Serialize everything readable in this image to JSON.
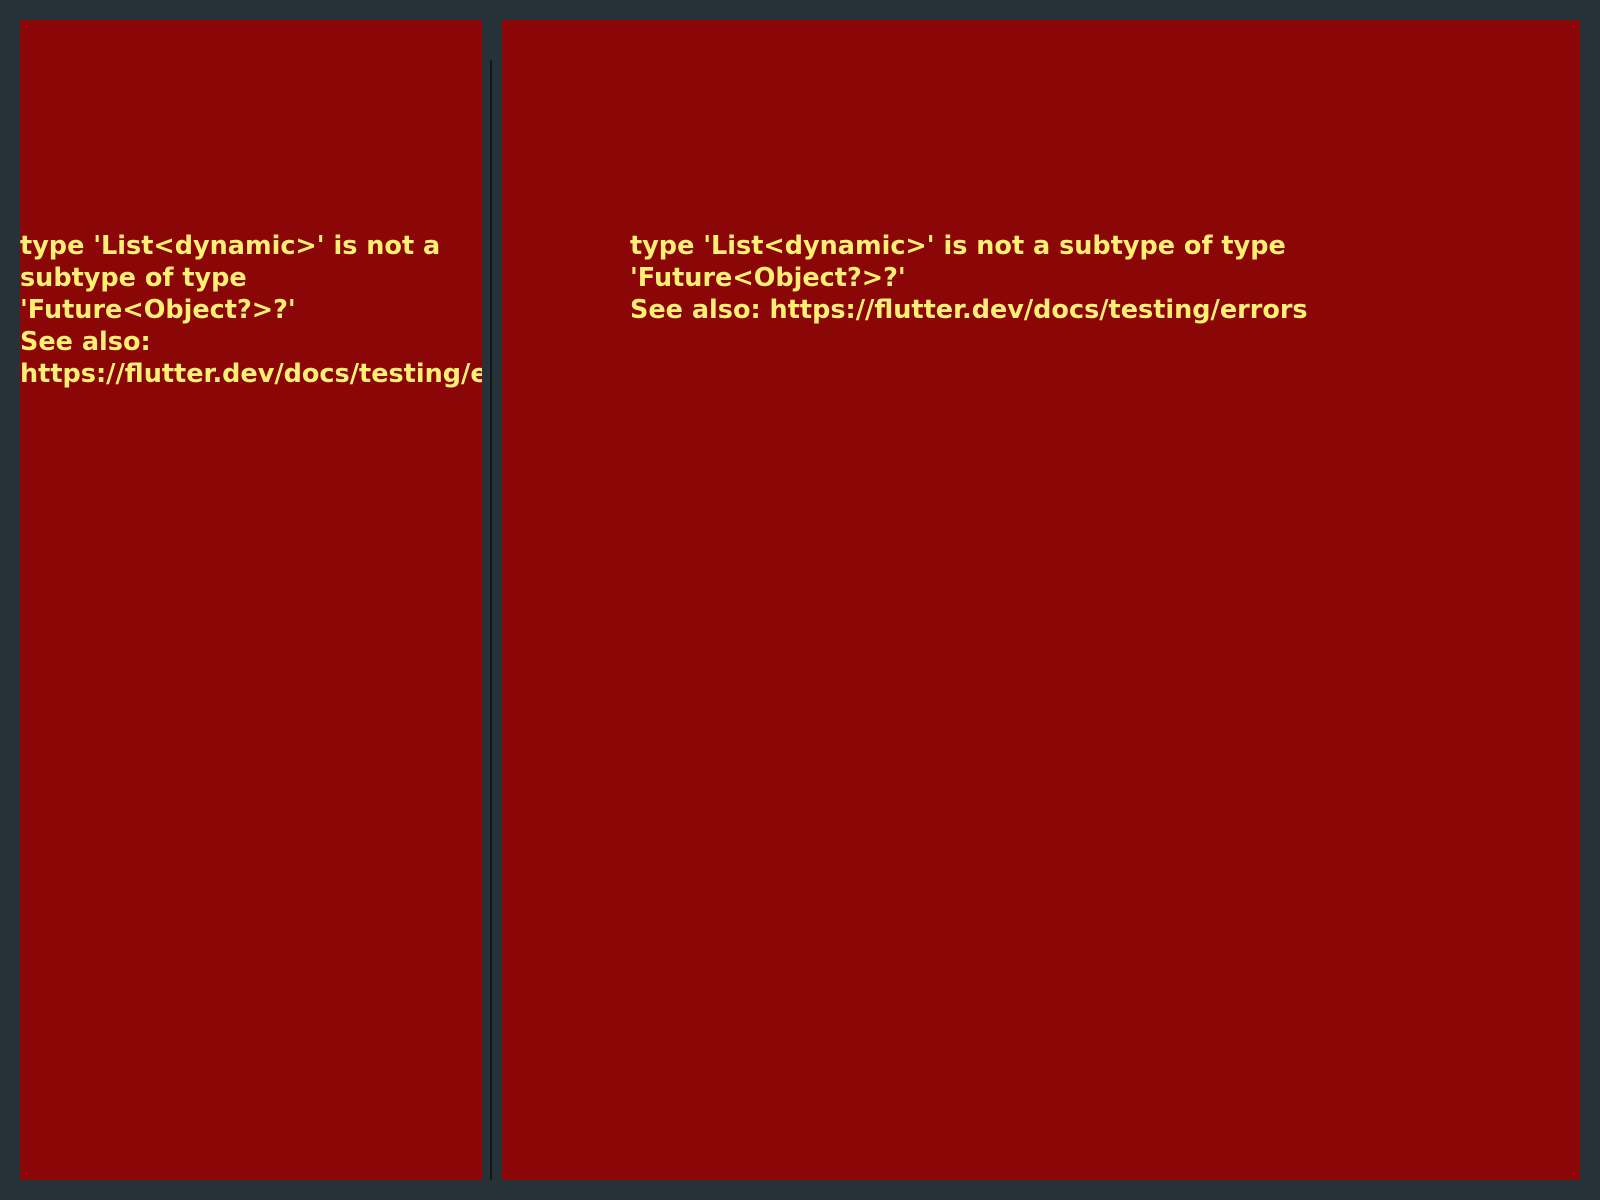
{
  "colors": {
    "background": "#263238",
    "panel": "#8b0606",
    "divider": "#10171b",
    "error_text": "#ffef75"
  },
  "left_panel": {
    "message": "type 'List<dynamic>' is not a subtype of type 'Future<Object?>?'",
    "see_also": "See also: https://flutter.dev/docs/testing/errors"
  },
  "right_panel": {
    "message": "type 'List<dynamic>' is not a subtype of type 'Future<Object?>?'",
    "see_also": "See also: https://flutter.dev/docs/testing/errors"
  }
}
